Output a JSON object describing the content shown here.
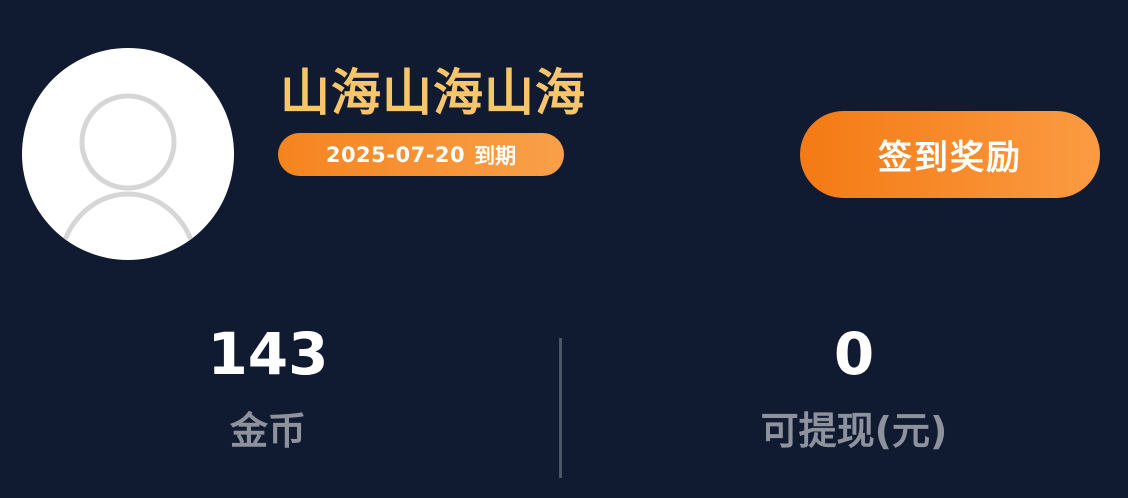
{
  "profile": {
    "username": "山海山海山海",
    "expiry_date": "2025-07-20",
    "expiry_suffix": "到期"
  },
  "actions": {
    "checkin_label": "签到奖励"
  },
  "stats": {
    "coins": {
      "value": "143",
      "label": "金币"
    },
    "withdrawable": {
      "value": "0",
      "label": "可提现(元)"
    }
  },
  "icons": {
    "avatar": "default-user-avatar-icon"
  },
  "colors": {
    "background": "#101b31",
    "username": "#f7c56a",
    "accent_orange": "#f5841f",
    "label_gray": "#8e929d"
  }
}
